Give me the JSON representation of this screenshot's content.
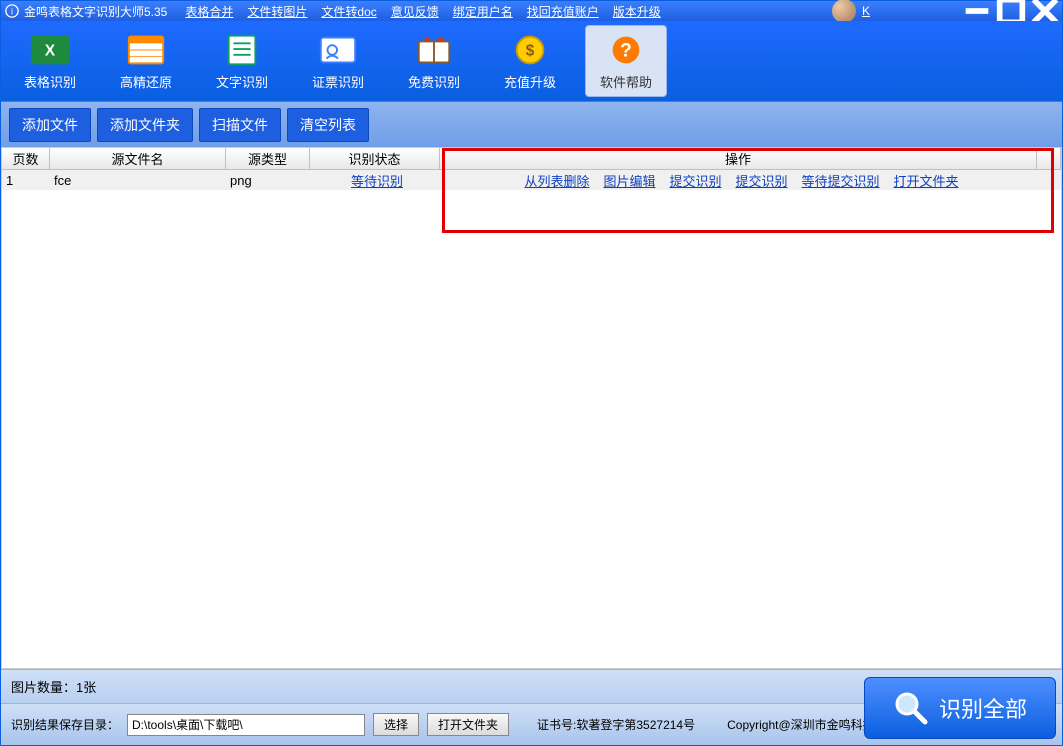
{
  "titlebar": {
    "app_title": "金鸣表格文字识别大师5.35",
    "links": [
      "表格合并",
      "文件转图片",
      "文件转doc",
      "意见反馈",
      "绑定用户名",
      "找回充值账户",
      "版本升级"
    ],
    "user": "K"
  },
  "toolbar": {
    "items": [
      {
        "label": "表格识别",
        "icon": "excel"
      },
      {
        "label": "高精还原",
        "icon": "layout"
      },
      {
        "label": "文字识别",
        "icon": "doc"
      },
      {
        "label": "证票识别",
        "icon": "id"
      },
      {
        "label": "免费识别",
        "icon": "book"
      },
      {
        "label": "充值升级",
        "icon": "coin"
      },
      {
        "label": "软件帮助",
        "icon": "help",
        "selected": true
      }
    ]
  },
  "actionbar": {
    "add_file": "添加文件",
    "add_folder": "添加文件夹",
    "scan_file": "扫描文件",
    "clear_list": "清空列表"
  },
  "table": {
    "headers": {
      "page": "页数",
      "file": "源文件名",
      "type": "源类型",
      "state": "识别状态",
      "ops": "操作"
    },
    "rows": [
      {
        "page": "1",
        "file": "fce",
        "type": "png",
        "state": "等待识别",
        "ops": [
          "从列表删除",
          "图片编辑",
          "提交识别",
          "提交识别",
          "等待提交识别",
          "打开文件夹"
        ]
      }
    ]
  },
  "footer": {
    "count_label": "图片数量：1张",
    "save_label": "识别结果保存目录：",
    "path": "D:\\tools\\桌面\\下载吧\\",
    "choose": "选择",
    "open_folder": "打开文件夹",
    "cert": "证书号:软著登字第3527214号",
    "copyright": "Copyright@深圳市金鸣科技有限公司",
    "recognize_all": "识别全部"
  }
}
